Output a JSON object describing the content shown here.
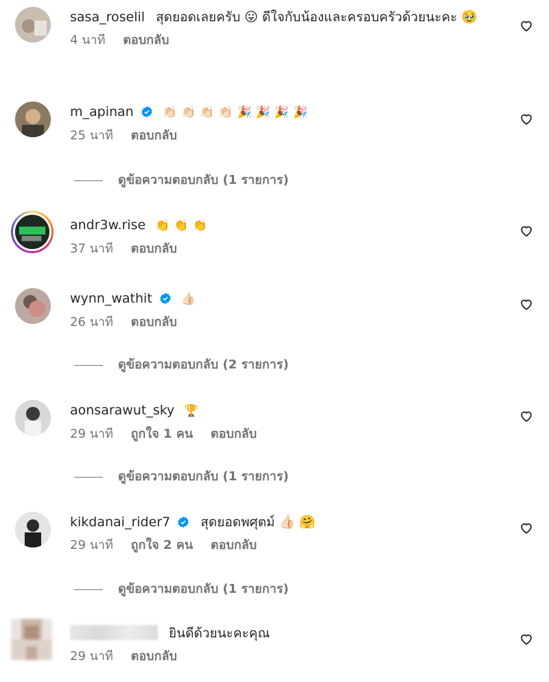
{
  "comments": [
    {
      "username": "sasa_roselil",
      "text": "สุดยอดเลยครับ 😛 ดีใจกับน้องและครอบครัวด้วยนะคะ 🥹",
      "time": "4 นาที",
      "likes": "",
      "reply": "ตอบกลับ",
      "verified": false
    },
    {
      "username": "m_apinan",
      "text": "👏🏻👏🏻👏🏻👏🏻🎉🎉🎉🎉",
      "time": "25 นาที",
      "likes": "",
      "reply": "ตอบกลับ",
      "verified": true,
      "view_replies": "ดูข้อความตอบกลับ (1 รายการ)"
    },
    {
      "username": "andr3w.rise",
      "text": "👏👏👏",
      "time": "37 นาที",
      "likes": "",
      "reply": "ตอบกลับ",
      "verified": false
    },
    {
      "username": "wynn_wathit",
      "text": "👍🏻",
      "time": "26 นาที",
      "likes": "",
      "reply": "ตอบกลับ",
      "verified": true,
      "view_replies": "ดูข้อความตอบกลับ (2 รายการ)"
    },
    {
      "username": "aonsarawut_sky",
      "text": "🏆",
      "time": "29 นาที",
      "likes": "ถูกใจ 1 คน",
      "reply": "ตอบกลับ",
      "verified": false,
      "view_replies": "ดูข้อความตอบกลับ (1 รายการ)"
    },
    {
      "username": "kikdanai_rider7",
      "text": "สุดยอดพศุตม์ 👍🏻 🤗",
      "time": "29 นาที",
      "likes": "ถูกใจ 2 คน",
      "reply": "ตอบกลับ",
      "verified": true,
      "view_replies": "ดูข้อความตอบกลับ (1 รายการ)"
    },
    {
      "username": "",
      "text": "ยินดีด้วยนะคะคุณ",
      "time": "29 นาที",
      "likes": "",
      "reply": "ตอบกลับ",
      "verified": false
    }
  ],
  "icons": {
    "like": "heart-outline-icon",
    "verified": "verified-badge-icon"
  },
  "colors": {
    "verified": "#0095f6",
    "secondary_text": "#737373",
    "primary_text": "#262626"
  }
}
